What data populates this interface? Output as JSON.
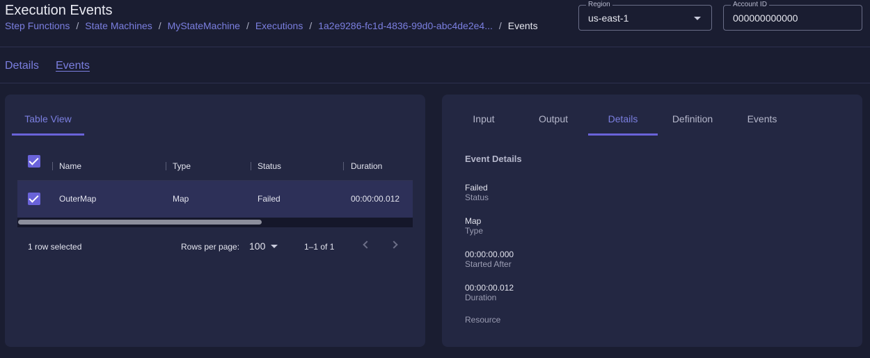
{
  "header": {
    "title": "Execution Events",
    "breadcrumb": [
      "Step Functions",
      "State Machines",
      "MyStateMachine",
      "Executions",
      "1a2e9286-fc1d-4836-99d0-abc4de2e4...",
      "Events"
    ],
    "separator": "/",
    "region": {
      "label": "Region",
      "value": "us-east-1"
    },
    "account": {
      "label": "Account ID",
      "value": "000000000000"
    }
  },
  "page_tabs": [
    "Details",
    "Events"
  ],
  "left_panel": {
    "tab": "Table View",
    "columns": [
      "Name",
      "Type",
      "Status",
      "Duration"
    ],
    "rows": [
      {
        "selected": true,
        "name": "OuterMap",
        "type": "Map",
        "status": "Failed",
        "duration": "00:00:00.012"
      }
    ],
    "footer": {
      "selected_text": "1 row selected",
      "rows_per_page_label": "Rows per page:",
      "rows_per_page_value": "100",
      "range": "1–1 of 1"
    }
  },
  "right_panel": {
    "tabs": [
      "Input",
      "Output",
      "Details",
      "Definition",
      "Events"
    ],
    "active_tab": "Details",
    "heading": "Event Details",
    "fields": [
      {
        "value": "Failed",
        "label": "Status"
      },
      {
        "value": "Map",
        "label": "Type"
      },
      {
        "value": "00:00:00.000",
        "label": "Started After"
      },
      {
        "value": "00:00:00.012",
        "label": "Duration"
      }
    ],
    "resource_label": "Resource"
  },
  "colors": {
    "background": "#1a1d31",
    "panel": "#232742",
    "accent": "#6a63d9",
    "link": "#7b7fe0",
    "selected_row": "#2d3058"
  },
  "icons": {
    "region_dropdown": "caret-down-icon",
    "rows_per_page_dropdown": "caret-down-icon",
    "prev_page": "chevron-left-icon",
    "next_page": "chevron-right-icon",
    "checkbox": "checkbox-checked-icon"
  }
}
